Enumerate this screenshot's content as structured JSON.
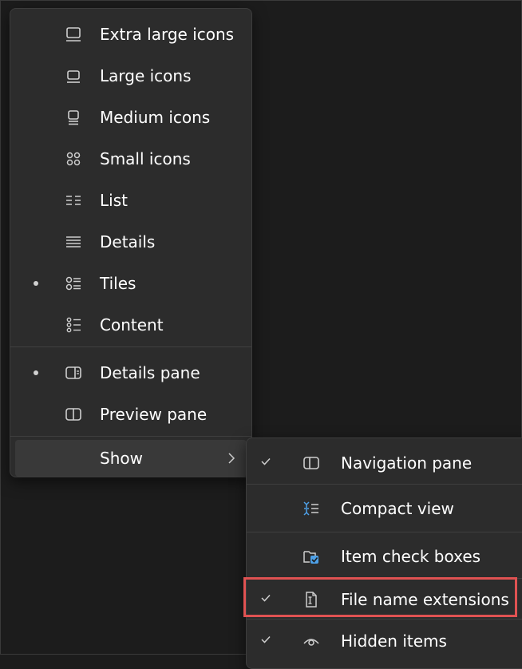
{
  "view_menu": {
    "items": [
      {
        "label": "Extra large icons",
        "icon": "extra-large-icons-icon",
        "selected": false
      },
      {
        "label": "Large icons",
        "icon": "large-icons-icon",
        "selected": false
      },
      {
        "label": "Medium icons",
        "icon": "medium-icons-icon",
        "selected": false
      },
      {
        "label": "Small icons",
        "icon": "small-icons-icon",
        "selected": false
      },
      {
        "label": "List",
        "icon": "list-icon",
        "selected": false
      },
      {
        "label": "Details",
        "icon": "details-icon",
        "selected": false
      },
      {
        "label": "Tiles",
        "icon": "tiles-icon",
        "selected": true
      },
      {
        "label": "Content",
        "icon": "content-icon",
        "selected": false
      }
    ],
    "panes": [
      {
        "label": "Details pane",
        "icon": "details-pane-icon",
        "selected": true
      },
      {
        "label": "Preview pane",
        "icon": "preview-pane-icon",
        "selected": false
      }
    ],
    "show": {
      "label": "Show",
      "icon": "chevron-right-icon"
    }
  },
  "show_submenu": {
    "items": [
      {
        "label": "Navigation pane",
        "icon": "navigation-pane-icon",
        "checked": true
      },
      {
        "label": "Compact view",
        "icon": "compact-view-icon",
        "checked": false
      },
      {
        "label": "Item check boxes",
        "icon": "item-check-boxes-icon",
        "checked": false
      },
      {
        "label": "File name extensions",
        "icon": "file-name-extensions-icon",
        "checked": true,
        "highlighted": true
      },
      {
        "label": "Hidden items",
        "icon": "hidden-items-icon",
        "checked": true
      }
    ]
  },
  "colors": {
    "background": "#1c1c1c",
    "menu": "#2c2c2c",
    "hover": "#393939",
    "text": "#ffffff",
    "icon": "#cfcfcf",
    "accent": "#4ea1e8",
    "highlight_border": "#e05252"
  }
}
